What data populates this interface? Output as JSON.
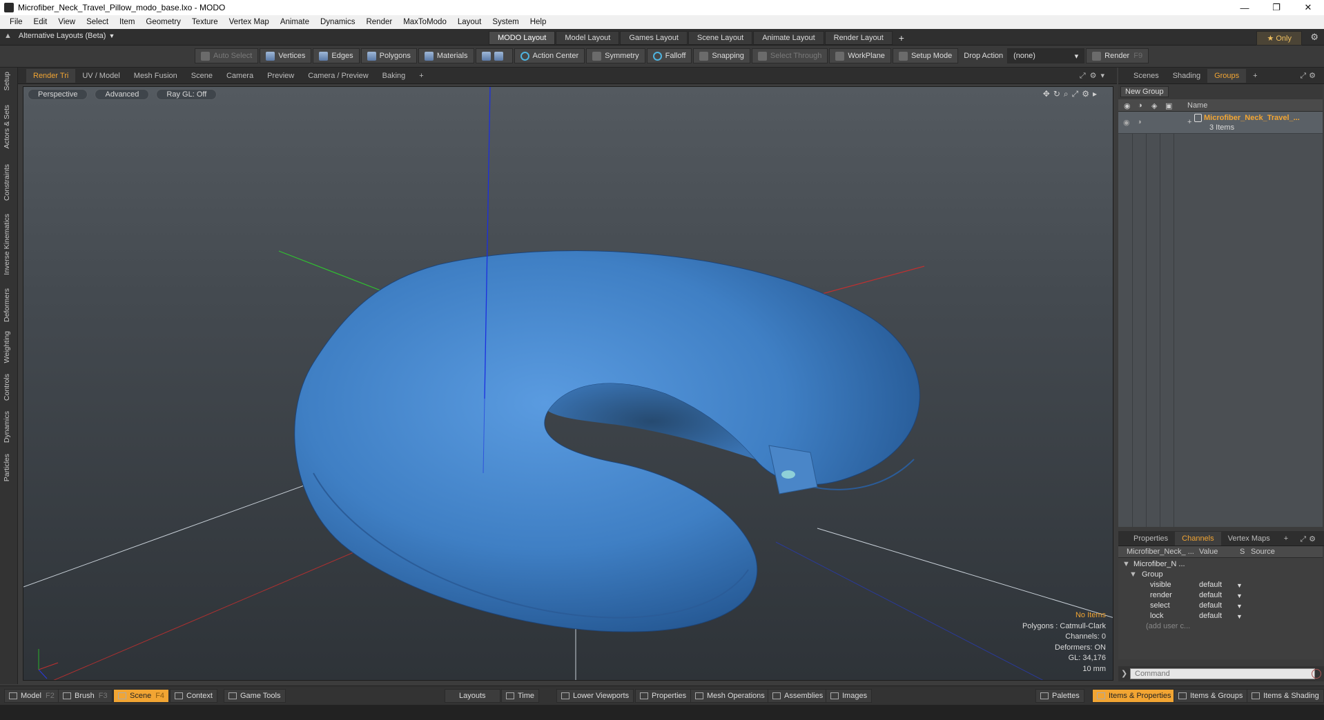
{
  "window": {
    "title": "Microfiber_Neck_Travel_Pillow_modo_base.lxo - MODO",
    "min": "—",
    "max": "❐",
    "close": "✕"
  },
  "menu": [
    "File",
    "Edit",
    "View",
    "Select",
    "Item",
    "Geometry",
    "Texture",
    "Vertex Map",
    "Animate",
    "Dynamics",
    "Render",
    "MaxToModo",
    "Layout",
    "System",
    "Help"
  ],
  "layoutbar": {
    "alt_label": "Alternative Layouts (Beta)",
    "tabs": [
      "MODO Layout",
      "Model Layout",
      "Games Layout",
      "Scene Layout",
      "Animate Layout",
      "Render Layout"
    ],
    "active_tab": 0,
    "plus": "+",
    "only": "★ Only"
  },
  "toolbar": {
    "auto_select": "Auto Select",
    "vertices": "Vertices",
    "edges": "Edges",
    "polygons": "Polygons",
    "materials": "Materials",
    "action_center": "Action Center",
    "symmetry": "Symmetry",
    "falloff": "Falloff",
    "snapping": "Snapping",
    "select_through": "Select Through",
    "workplane": "WorkPlane",
    "setup_mode": "Setup Mode",
    "drop_action": "Drop Action",
    "drop_value": "(none)",
    "render": "Render",
    "render_key": "F9"
  },
  "lefttabs": [
    "Setup",
    "Actors & Sets",
    "Constraints",
    "Inverse Kinematics",
    "Deformers",
    "Weighting",
    "Controls",
    "Dynamics",
    "Particles"
  ],
  "viewport_tabs": [
    "Render Tri",
    "UV / Model",
    "Mesh Fusion",
    "Scene",
    "Camera",
    "Preview",
    "Camera / Preview",
    "Baking",
    "+"
  ],
  "viewport": {
    "pills": [
      "Perspective",
      "Advanced",
      "Ray GL: Off"
    ],
    "info": {
      "items": "No Items",
      "polygons": "Polygons : Catmull-Clark",
      "channels": "Channels: 0",
      "deformers": "Deformers: ON",
      "gl": "GL: 34,176",
      "scale": "10 mm"
    }
  },
  "right_top_tabs": [
    "Scenes",
    "Shading",
    "Groups",
    "+"
  ],
  "groups": {
    "new_group": "New Group",
    "name_header": "Name",
    "item_name": "Microfiber_Neck_Travel_...",
    "item_sub": "3 Items"
  },
  "right_bottom_tabs": [
    "Properties",
    "Channels",
    "Vertex Maps",
    "+"
  ],
  "channels": {
    "headers": [
      "Microfiber_Neck_ ...",
      "Value",
      "S",
      "Source"
    ],
    "rows": [
      {
        "name": "Microfiber_N ...",
        "value": ""
      },
      {
        "name": "Group",
        "value": ""
      },
      {
        "name": "visible",
        "value": "default"
      },
      {
        "name": "render",
        "value": "default"
      },
      {
        "name": "select",
        "value": "default"
      },
      {
        "name": "lock",
        "value": "default"
      },
      {
        "name": "(add user c...",
        "value": ""
      }
    ]
  },
  "command": {
    "placeholder": "Command"
  },
  "bottom": {
    "model": "Model",
    "model_key": "F2",
    "brush": "Brush",
    "brush_key": "F3",
    "scene": "Scene",
    "scene_key": "F4",
    "context": "Context",
    "game_tools": "Game Tools",
    "layouts": "Layouts",
    "time": "Time",
    "lower_viewports": "Lower Viewports",
    "properties": "Properties",
    "mesh_operations": "Mesh Operations",
    "assemblies": "Assemblies",
    "images": "Images",
    "palettes": "Palettes",
    "items_properties": "Items & Properties",
    "items_groups": "Items & Groups",
    "items_shading": "Items & Shading"
  },
  "colors": {
    "accent": "#f2a533",
    "pillow": "#3f7fc4"
  }
}
